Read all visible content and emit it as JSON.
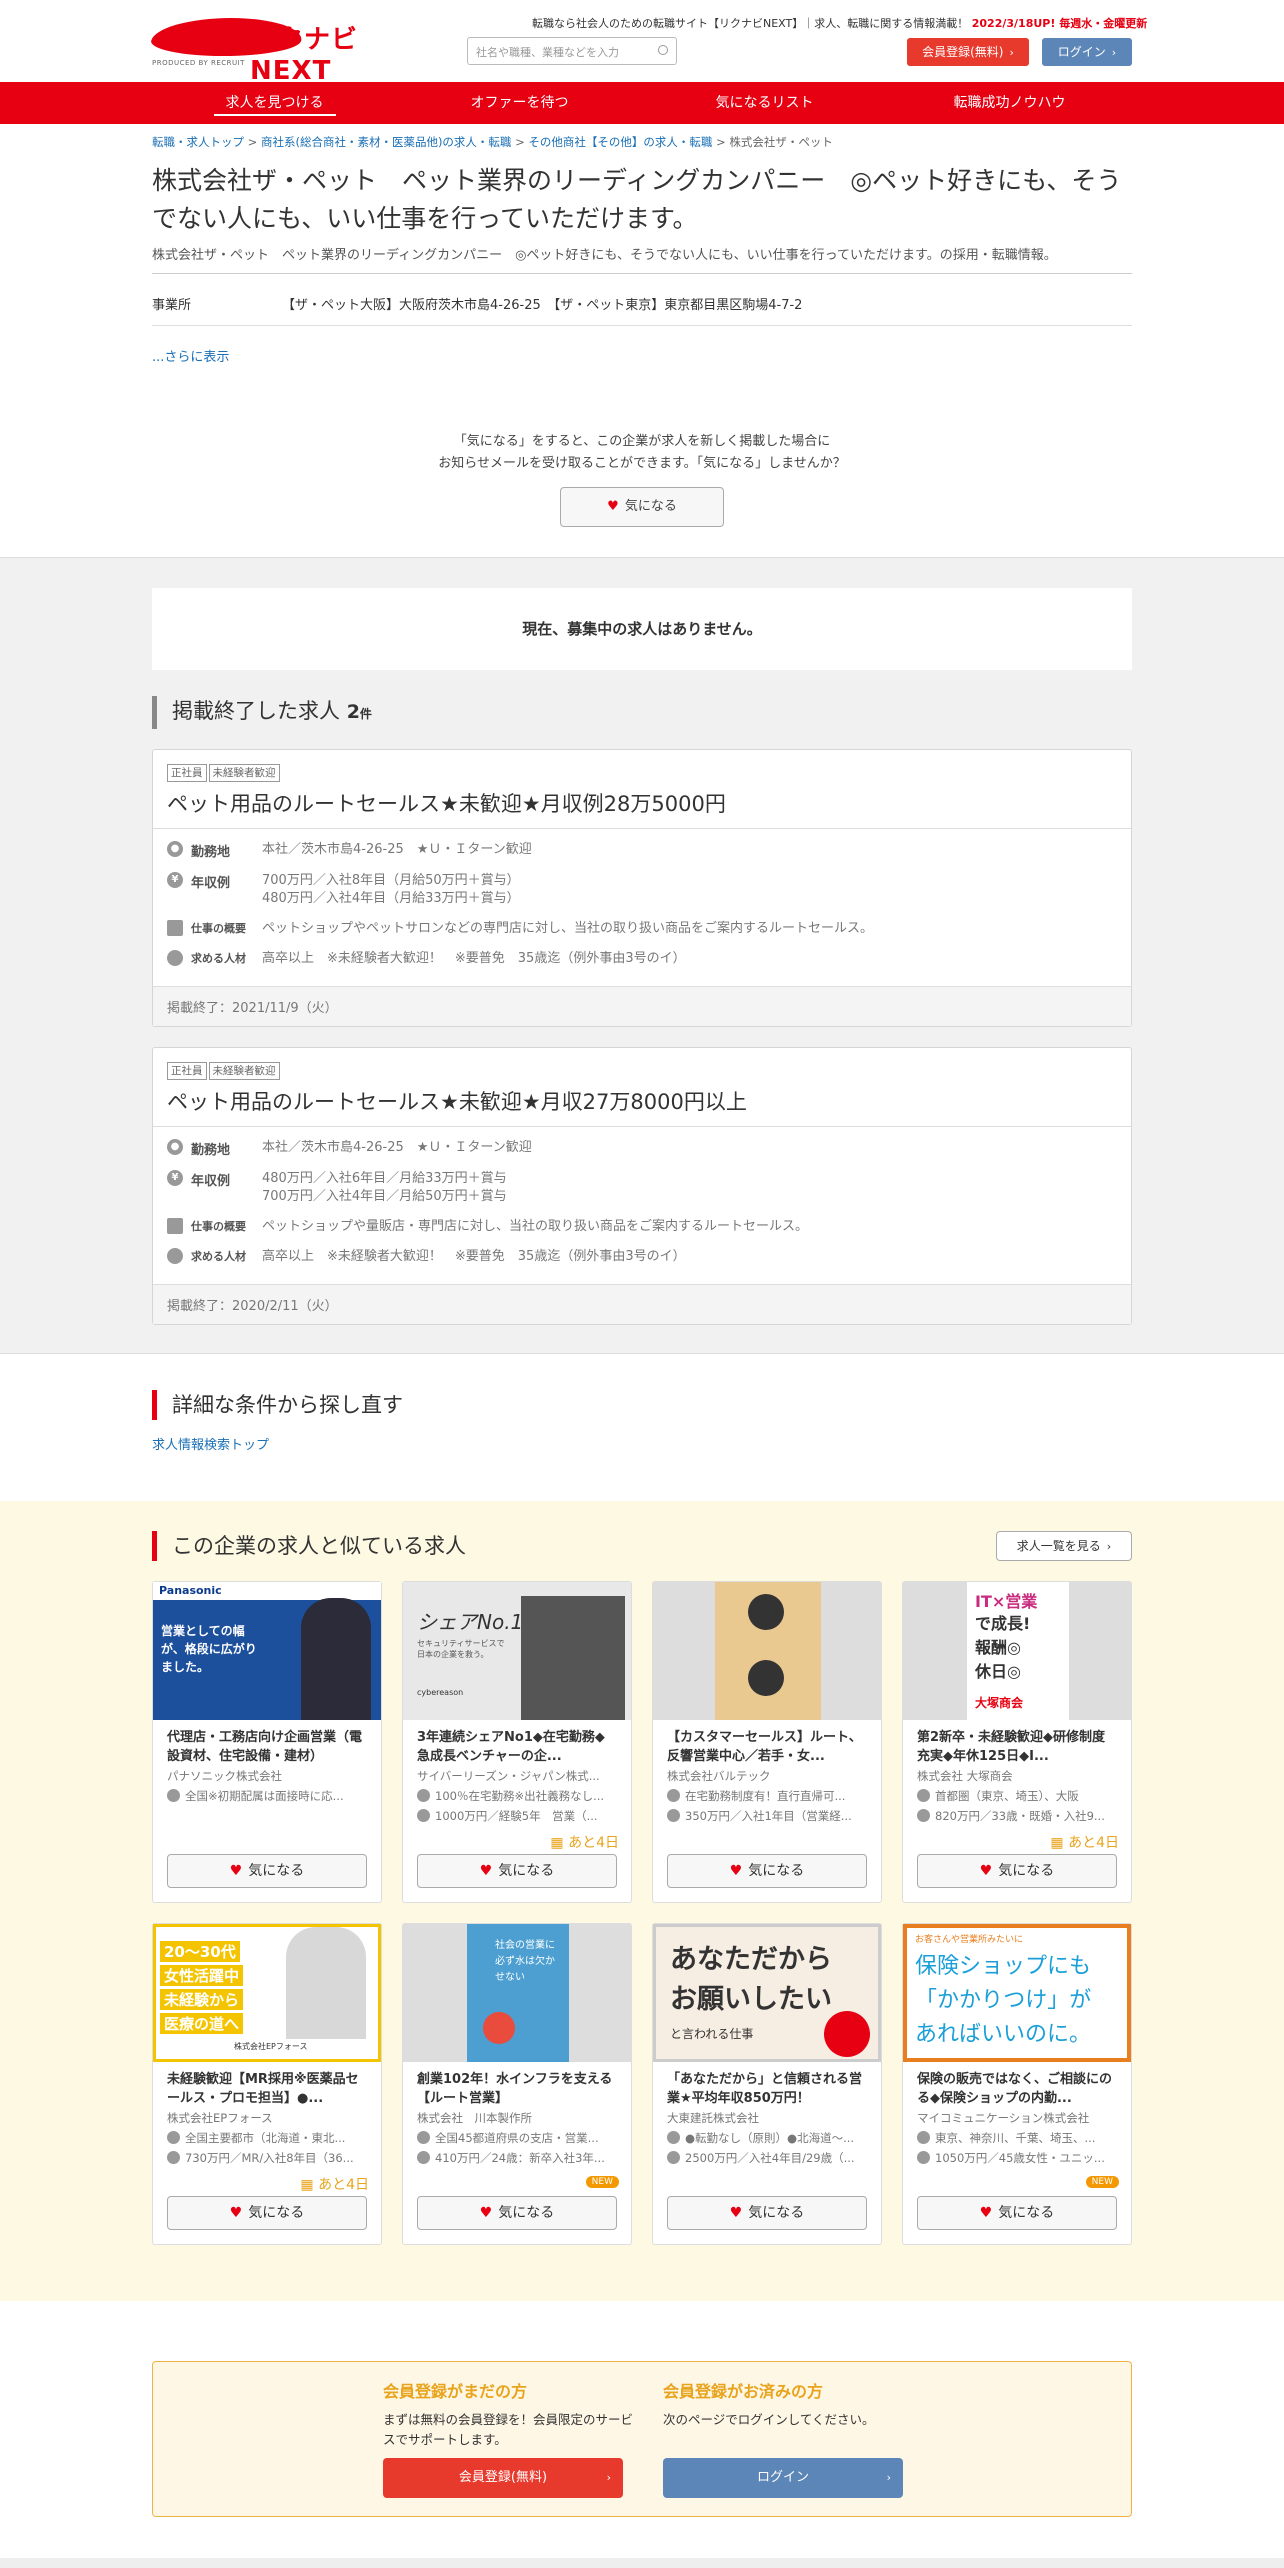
{
  "header": {
    "logo_text": "リクナビNEXT",
    "logo_sub": "PRODUCED BY RECRUIT",
    "tagline": "転職なら社会人のための転職サイト【リクナビNEXT】｜求人、転職に関する情報満載！",
    "tagline_highlight": "2022/3/18UP! 毎週水・金曜更新",
    "search_placeholder": "社名や職種、業種などを入力",
    "register_label": "会員登録(無料)",
    "login_label": "ログイン"
  },
  "nav": [
    "求人を見つける",
    "オファーを待つ",
    "気になるリスト",
    "転職成功ノウハウ"
  ],
  "breadcrumb": [
    "転職・求人トップ",
    "商社系(総合商社・素材・医薬品他)の求人・転職",
    "その他商社【その他】の求人・転職",
    "株式会社ザ・ペット"
  ],
  "company": {
    "title": "株式会社ザ・ペット　ペット業界のリーディングカンパニー　◎ペット好きにも、そうでない人にも、いい仕事を行っていただけます。",
    "subtitle": "株式会社ザ・ペット　ペット業界のリーディングカンパニー　◎ペット好きにも、そうでない人にも、いい仕事を行っていただけます。の採用・転職情報。",
    "office_label": "事業所",
    "office_value": "【ザ・ペット大阪】大阪府茨木市島4-26-25　【ザ・ペット東京】東京都目黒区駒場4-7-2",
    "more": "...さらに表示"
  },
  "fav_prompt": {
    "line1": "「気になる」をすると、この企業が求人を新しく掲載した場合に",
    "line2": "お知らせメールを受け取ることができます。「気になる」しませんか？",
    "button": "気になる"
  },
  "no_jobs": "現在、募集中の求人はありません。",
  "ended_section": {
    "title": "掲載終了した求人",
    "count": "2",
    "unit": "件"
  },
  "ended_jobs": [
    {
      "tags": [
        "正社員",
        "未経験者歓迎"
      ],
      "title": "ペット用品のルートセールス★未歓迎★月収例28万5000円",
      "loc_label": "勤務地",
      "loc": "本社／茨木市島4-26-25　★Ｕ・Ｉターン歓迎",
      "pay_label": "年収例",
      "pay1": "700万円／入社8年目（月給50万円＋賞与）",
      "pay2": "480万円／入社4年目（月給33万円＋賞与）",
      "desc_label": "仕事の概要",
      "desc": "ペットショップやペットサロンなどの専門店に対し、当社の取り扱い商品をご案内するルートセールス。",
      "req_label": "求める人材",
      "req": "高卒以上　※未経験者大歓迎！　※要普免　35歳迄（例外事由3号のイ）",
      "ended": "掲載終了：2021/11/9（火）"
    },
    {
      "tags": [
        "正社員",
        "未経験者歓迎"
      ],
      "title": "ペット用品のルートセールス★未歓迎★月収27万8000円以上",
      "loc_label": "勤務地",
      "loc": "本社／茨木市島4-26-25　★Ｕ・Ｉターン歓迎",
      "pay_label": "年収例",
      "pay1": "480万円／入社6年目／月給33万円＋賞与",
      "pay2": "700万円／入社4年目／月給50万円＋賞与",
      "desc_label": "仕事の概要",
      "desc": "ペットショップや量販店・専門店に対し、当社の取り扱い商品をご案内するルートセールス。",
      "req_label": "求める人材",
      "req": "高卒以上　※未経験者大歓迎！　※要普免　35歳迄（例外事由3号のイ）",
      "ended": "掲載終了：2020/2/11（火）"
    }
  ],
  "search_again": {
    "title": "詳細な条件から探し直す",
    "link": "求人情報検索トップ"
  },
  "similar": {
    "title": "この企業の求人と似ている求人",
    "list_button": "求人一覧を見る",
    "fav": "気になる",
    "jobs": [
      {
        "title": "代理店・工務店向け企画営業（電設資材、住宅設備・建材）",
        "company": "パナソニック株式会社",
        "l1": "全国※初期配属は面接時に応...",
        "l2": "",
        "badge": "",
        "thumb": "panasonic"
      },
      {
        "title": "3年連続シェアNo1◆在宅勤務◆急成長ベンチャーの企...",
        "company": "サイバーリーズン・ジャパン株式...",
        "l1": "100％在宅勤務※出社義務なし...",
        "l2": "1000万円／経験5年　営業（...",
        "badge": "あと4日",
        "thumb": "cyber"
      },
      {
        "title": "【カスタマーセールス】ルート、反響営業中心／若手・女...",
        "company": "株式会社バルテック",
        "l1": "在宅勤務制度有！直行直帰可...",
        "l2": "350万円／入社1年目（営業経...",
        "badge": "",
        "thumb": "people"
      },
      {
        "title": "第2新卒・未経験歓迎◆研修制度充実◆年休125日◆I...",
        "company": "株式会社 大塚商会",
        "l1": "首都圏（東京、埼玉）、大阪",
        "l2": "820万円／33歳・既婚・入社9...",
        "badge": "あと4日",
        "thumb": "otsuka"
      },
      {
        "title": "未経験歓迎【MR採用※医薬品セールス・プロモ担当】●...",
        "company": "株式会社EPフォース",
        "l1": "全国主要都市（北海道・東北...",
        "l2": "730万円／MR/入社8年目（36...",
        "badge": "あと4日",
        "thumb": "ep"
      },
      {
        "title": "創業102年！水インフラを支える【ルート営業】",
        "company": "株式会社　川本製作所",
        "l1": "全国45都道府県の支店・営業...",
        "l2": "410万円／24歳：新卒入社3年...",
        "badge": "NEW",
        "thumb": "water"
      },
      {
        "title": "「あなただから」と信頼される営業★平均年収850万円！",
        "company": "大東建託株式会社",
        "l1": "●転勤なし（原則）●北海道～...",
        "l2": "2500万円／入社4年目/29歳（...",
        "badge": "",
        "thumb": "daito"
      },
      {
        "title": "保険の販売ではなく、ご相談にのる◆保険ショップの内勤...",
        "company": "マイコミュニケーション株式会社",
        "l1": "東京、神奈川、千葉、埼玉、...",
        "l2": "1050万円／45歳女性・ユニッ...",
        "badge": "NEW",
        "thumb": "hoken"
      }
    ]
  },
  "thumbs": {
    "panasonic_brand": "Panasonic",
    "panasonic_copy": "営業としての幅が、格段に広がりました。",
    "cyber_copy": "シェアNo.1",
    "cyber_sub": "セキュリティサービスで日本の企業を救う。",
    "cyber_brand": "cybereason",
    "otsuka_copy1": "IT×営業",
    "otsuka_copy2": "で成長!",
    "otsuka_copy3": "報酬◎",
    "otsuka_copy4": "休日◎",
    "otsuka_brand": "大塚商会",
    "ep_copy1": "20～30代",
    "ep_copy2": "女性活躍中",
    "ep_copy3": "未経験から",
    "ep_copy4": "医療の道へ",
    "ep_brand": "株式会社EPフォース",
    "water_copy": "社会の営業に必ず水は欠かせない",
    "daito_copy1": "あなただから",
    "daito_copy2": "お願いしたい",
    "daito_copy3": "と言われる仕事",
    "hoken_copy1": "お客さんや営業所みたいに",
    "hoken_copy2": "保険ショップにも",
    "hoken_copy3": "「かかりつけ」が",
    "hoken_copy4": "あればいいのに。"
  },
  "register": {
    "left_title": "会員登録がまだの方",
    "left_text": "まずは無料の会員登録を！会員限定のサービスでサポートします。",
    "left_button": "会員登録(無料)",
    "right_title": "会員登録がお済みの方",
    "right_text": "次のページでログインしてください。",
    "right_button": "ログイン"
  },
  "colors": {
    "brand_red": "#e60012",
    "login_blue": "#5d86b8",
    "badge_orange": "#e8a41c"
  }
}
